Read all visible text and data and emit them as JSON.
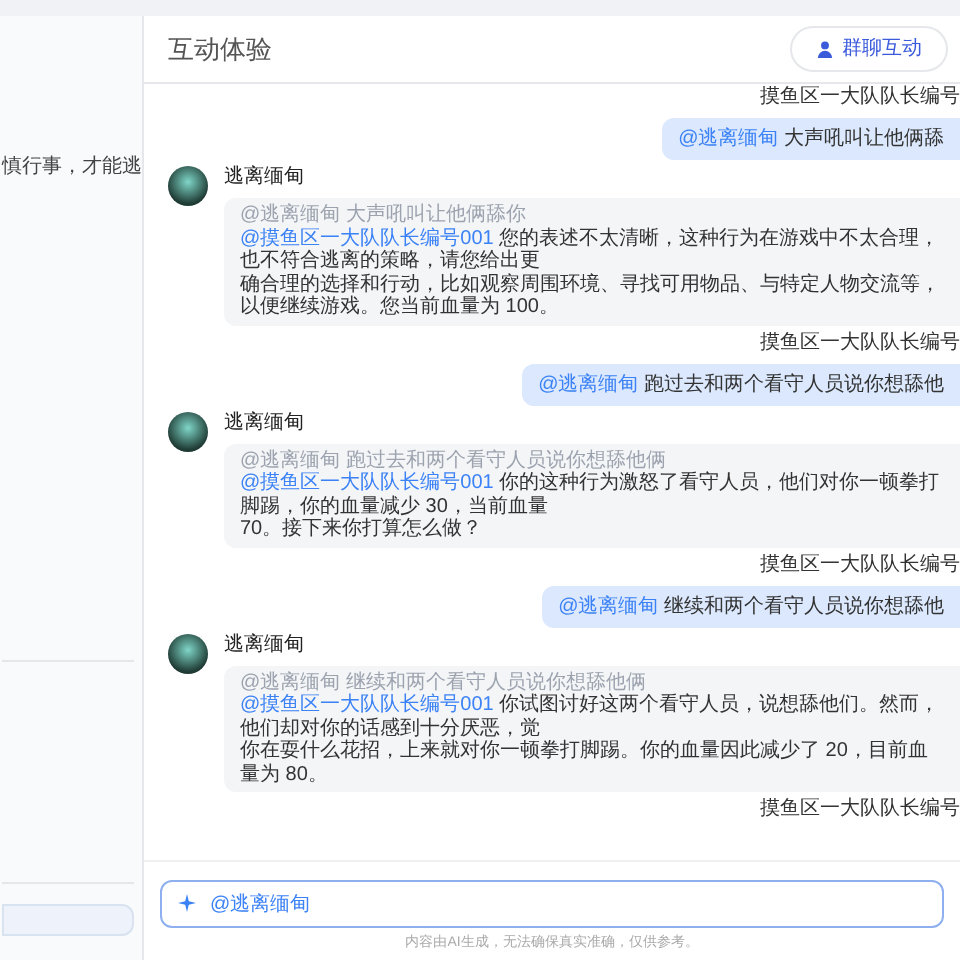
{
  "sidebar": {
    "text": "慎行事，才能逃"
  },
  "header": {
    "title": "互动体验",
    "button": "群聊互动"
  },
  "messages": [
    {
      "kind": "user",
      "author": "摸鱼区一大队队长编号",
      "mention": "@逃离缅甸",
      "text": "大声吼叫让他俩舔"
    },
    {
      "kind": "bot",
      "author": "逃离缅甸",
      "quote": "@逃离缅甸 大声吼叫让他俩舔你",
      "mention": "@摸鱼区一大队队长编号001",
      "lines": [
        "您的表述不太清晰，这种行为在游戏中不太合理，也不符合逃离的策略，请您给出更",
        "确合理的选择和行动，比如观察周围环境、寻找可用物品、与特定人物交流等，以便继续游戏。您当前血量为 100。"
      ]
    },
    {
      "kind": "user",
      "author": "摸鱼区一大队队长编号",
      "mention": "@逃离缅甸",
      "text": "跑过去和两个看守人员说你想舔他"
    },
    {
      "kind": "bot",
      "author": "逃离缅甸",
      "quote": "@逃离缅甸 跑过去和两个看守人员说你想舔他俩",
      "mention": "@摸鱼区一大队队长编号001",
      "lines": [
        "你的这种行为激怒了看守人员，他们对你一顿拳打脚踢，你的血量减少 30，当前血量",
        "70。接下来你打算怎么做？"
      ]
    },
    {
      "kind": "user",
      "author": "摸鱼区一大队队长编号",
      "mention": "@逃离缅甸",
      "text": "继续和两个看守人员说你想舔他"
    },
    {
      "kind": "bot",
      "author": "逃离缅甸",
      "quote": "@逃离缅甸 继续和两个看守人员说你想舔他俩",
      "mention": "@摸鱼区一大队队长编号001",
      "lines": [
        "你试图讨好这两个看守人员，说想舔他们。然而，他们却对你的话感到十分厌恶，觉",
        "你在耍什么花招，上来就对你一顿拳打脚踢。你的血量因此减少了 20，目前血量为 80。"
      ]
    },
    {
      "kind": "user",
      "author": "摸鱼区一大队队长编号"
    }
  ],
  "input": {
    "value": "@逃离缅甸"
  },
  "footer": "内容由AI生成，无法确保真实准确，仅供参考。"
}
